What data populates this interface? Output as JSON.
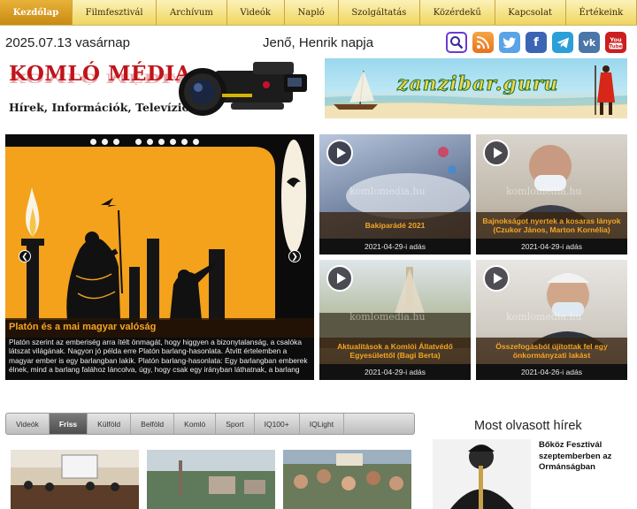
{
  "nav": {
    "items": [
      {
        "label": "Kezdőlap",
        "active": true
      },
      {
        "label": "Filmfesztivál",
        "active": false
      },
      {
        "label": "Archívum",
        "active": false
      },
      {
        "label": "Videók",
        "active": false
      },
      {
        "label": "Napló",
        "active": false
      },
      {
        "label": "Szolgáltatás",
        "active": false
      },
      {
        "label": "Közérdekű",
        "active": false
      },
      {
        "label": "Kapcsolat",
        "active": false
      },
      {
        "label": "Értékeink",
        "active": false
      }
    ]
  },
  "header": {
    "date": "2025.07.13 vasárnap",
    "nameday": "Jenő, Henrik napja",
    "social_icons": [
      "search-icon",
      "rss-icon",
      "twitter-icon",
      "facebook-icon",
      "telegram-icon",
      "vk-icon",
      "youtube-icon"
    ]
  },
  "logo": {
    "title": "KOMLÓ MÉDIA",
    "tagline": "Hírek, Információk, Televízió"
  },
  "banner": {
    "text": "zanzibar.guru"
  },
  "hero": {
    "title": "Platón és a mai magyar valóság",
    "body": "Platón szerint az emberiség arra ítélt önmagát, hogy higgyen a bizonytalanság, a csalóka látszat világának. Nagyon jó példa erre Platón barlang-hasonlata. Átvitt értelemben a magyar ember is egy barlangban lakik. Platón barlang-hasonlata: Egy barlangban emberek élnek, mind a barlang falához láncolva, úgy, hogy csak egy irányban láthatnak, a barlang"
  },
  "videos": [
    {
      "title": "Bakiparádé 2021",
      "date": "2021-04-29-i adás"
    },
    {
      "title": "Bajnokságot nyertek a kosaras lányok (Czukor János, Marton Kornélia)",
      "date": "2021-04-29-i adás"
    },
    {
      "title": "Aktualitások a Komlói Állatvédő Egyesülettől (Bagi Berta)",
      "date": "2021-04-29-i adás"
    },
    {
      "title": "Összefogásból újítottak fel egy önkormányzati lakást",
      "date": "2021-04-26-i adás"
    }
  ],
  "watermark": "komlomedia.hu",
  "tabs": [
    {
      "label": "Videók",
      "active": false
    },
    {
      "label": "Friss",
      "active": true
    },
    {
      "label": "Külföld",
      "active": false
    },
    {
      "label": "Belföld",
      "active": false
    },
    {
      "label": "Komló",
      "active": false
    },
    {
      "label": "Sport",
      "active": false
    },
    {
      "label": "IQ100+",
      "active": false
    },
    {
      "label": "IQLight",
      "active": false
    }
  ],
  "most_read": {
    "heading": "Most olvasott hírek",
    "item": "Bőköz Fesztivál szeptemberben az Ormánságban"
  },
  "colors": {
    "nav_bg": "#f0d560",
    "nav_active": "#c98a12",
    "caption_text": "#f5a623",
    "logo_red": "#c0141b"
  }
}
